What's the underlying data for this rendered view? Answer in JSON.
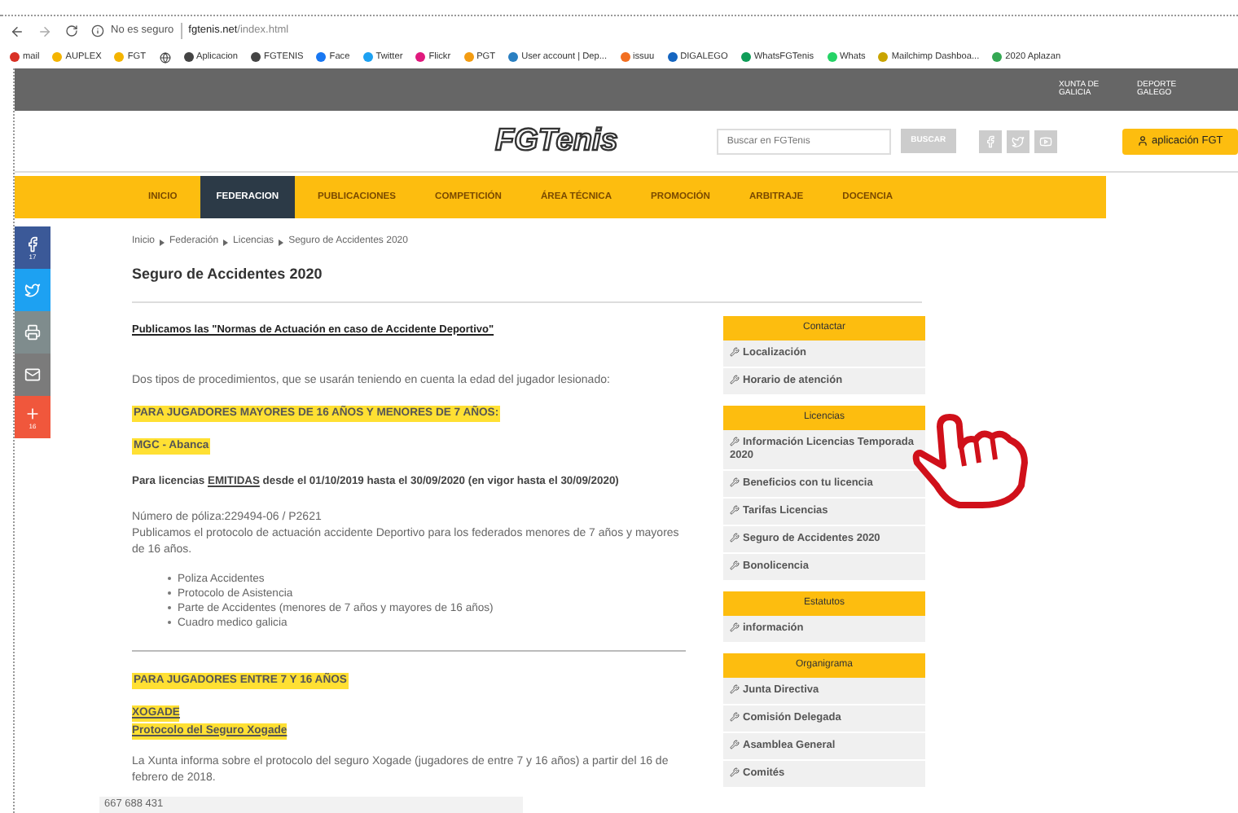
{
  "browser": {
    "security": "No es seguro",
    "url_host": "fgtenis.net",
    "url_path": "/index.html",
    "bookmarks": [
      {
        "label": "mail",
        "color": "#d93025"
      },
      {
        "label": "AUPLEX",
        "color": "#f4b400"
      },
      {
        "label": "FGT",
        "color": "#f4b400"
      },
      {
        "color": "#444444"
      },
      {
        "label": "Aplicacion",
        "color": "#444444"
      },
      {
        "label": "FGTENIS",
        "color": "#444444"
      },
      {
        "label": "Face",
        "color": "#1877f2"
      },
      {
        "label": "Twitter",
        "color": "#1da1f2"
      },
      {
        "label": "Flickr",
        "color": "#e0197d"
      },
      {
        "label": "PGT",
        "color": "#f39c12"
      },
      {
        "label": "User account | Dep...",
        "color": "#2a7fc1"
      },
      {
        "label": "issuu",
        "color": "#f26f21"
      },
      {
        "label": "DIGALEGO",
        "color": "#1565c0"
      },
      {
        "label": "WhatsFGTenis",
        "color": "#0f9d58"
      },
      {
        "label": "Whats",
        "color": "#25d366"
      },
      {
        "label": "Mailchimp Dashboa...",
        "color": "#c9a400"
      },
      {
        "label": "2020 Aplazan",
        "color": "#34a853"
      }
    ]
  },
  "banner": {
    "logos": [
      "XUNTA DE GALICIA",
      "DEPORTE GALEGO"
    ]
  },
  "header": {
    "logo": "FGTenis",
    "search_placeholder": "Buscar en FGTenis",
    "search_button": "BUSCAR",
    "app_button": "aplicación FGT"
  },
  "nav": [
    {
      "label": "INICIO",
      "selected": false
    },
    {
      "label": "FEDERACION",
      "selected": true
    },
    {
      "label": "PUBLICACIONES",
      "selected": false
    },
    {
      "label": "COMPETICIÓN",
      "selected": false
    },
    {
      "label": "ÁREA TÉCNICA",
      "selected": false
    },
    {
      "label": "PROMOCIÓN",
      "selected": false
    },
    {
      "label": "ARBITRAJE",
      "selected": false
    },
    {
      "label": "DOCENCIA",
      "selected": false
    }
  ],
  "share": [
    {
      "kind": "facebook",
      "count": "17"
    },
    {
      "kind": "twitter"
    },
    {
      "kind": "print"
    },
    {
      "kind": "mail"
    },
    {
      "kind": "plus",
      "count": "16"
    }
  ],
  "breadcrumb": [
    "Inicio",
    "Federación",
    "Licencias",
    "Seguro de Accidentes 2020"
  ],
  "title": "Seguro de Accidentes 2020",
  "content": [
    {
      "kind": "link",
      "text": "Publicamos las \"Normas de Actuación en caso de Accidente Deportivo\""
    },
    {
      "kind": "paragraph",
      "text": "Dos tipos de procedimientos, que se usarán teniendo en cuenta la edad del jugador lesionado:"
    },
    {
      "kind": "highlight",
      "text": "PARA JUGADORES MAYORES DE 16 AÑOS Y MENORES DE 7 AÑOS:"
    },
    {
      "kind": "highlight",
      "text": "MGC - Abanca"
    },
    {
      "kind": "boldline",
      "parts": [
        {
          "text": "Para licencias ",
          "underline": false
        },
        {
          "text": "EMITIDAS",
          "underline": true
        },
        {
          "text": " desde el 01/10/2019 hasta el 30/09/2020 (en vigor hasta el 30/09/2020)",
          "underline": false
        }
      ]
    },
    {
      "kind": "lines",
      "lines": [
        "Número de póliza:229494-06 / P2621",
        "Publicamos el protocolo de actuación accidente Deportivo para los federados menores de 7 años y mayores de 16 años."
      ]
    },
    {
      "kind": "list",
      "items": [
        "Poliza Accidentes",
        "Protocolo de Asistencia",
        "Parte de Accidentes (menores de 7 años y mayores de 16 años)",
        "Cuadro medico galicia"
      ]
    },
    {
      "kind": "rule"
    },
    {
      "kind": "highlight",
      "text": "PARA JUGADORES ENTRE 7 Y 16 AÑOS"
    },
    {
      "kind": "highlight-links",
      "lines": [
        "XOGADE",
        "Protocolo del Seguro Xogade"
      ]
    },
    {
      "kind": "paragraph",
      "text": "La Xunta informa sobre el protocolo del seguro Xogade (jugadores de entre 7 y 16 años) a partir del 16 de febrero de 2018."
    }
  ],
  "footer_overlay": "667 688 431",
  "sidebar": [
    {
      "title": "Contactar",
      "items": [
        "Localización",
        "Horario de atención"
      ]
    },
    {
      "title": "Licencias",
      "items": [
        "Información Licencias Temporada 2020",
        "Beneficios con tu licencia",
        "Tarifas Licencias",
        "Seguro de Accidentes 2020",
        "Bonolicencia"
      ]
    },
    {
      "title": "Estatutos",
      "items": [
        "información"
      ]
    },
    {
      "title": "Organigrama",
      "items": [
        "Junta Directiva",
        "Comisión Delegada",
        "Asamblea General",
        "Comités"
      ]
    }
  ]
}
